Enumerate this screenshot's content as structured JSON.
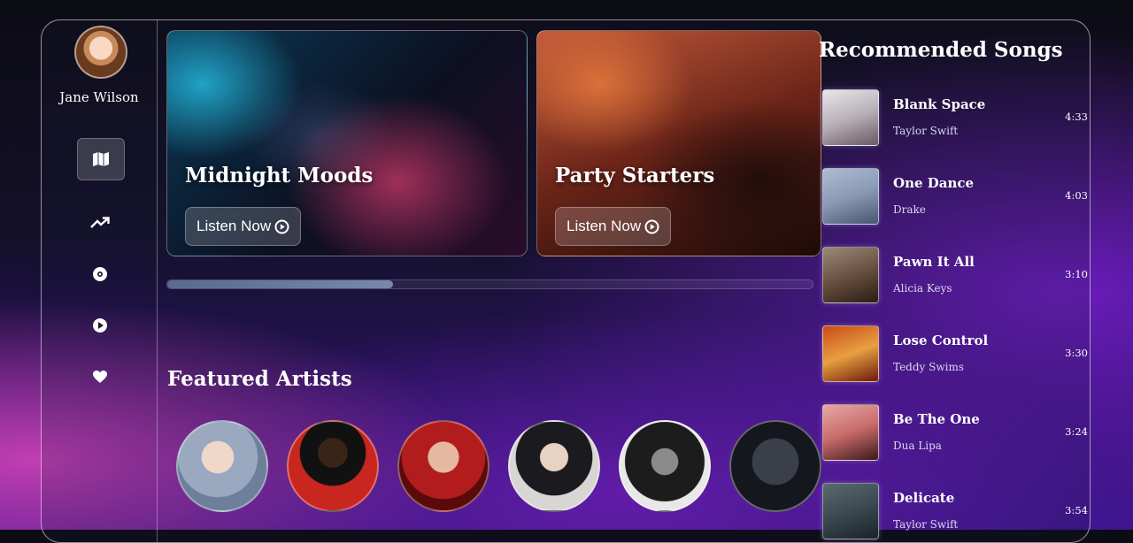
{
  "user": {
    "name": "Jane Wilson"
  },
  "nav": [
    {
      "icon": "map-icon",
      "active": true
    },
    {
      "icon": "trending-icon",
      "active": false
    },
    {
      "icon": "disc-icon",
      "active": false
    },
    {
      "icon": "play-icon",
      "active": false
    },
    {
      "icon": "heart-icon",
      "active": false
    }
  ],
  "playlists": [
    {
      "title": "Midnight Moods",
      "button": "Listen Now"
    },
    {
      "title": "Party Starters",
      "button": "Listen Now"
    }
  ],
  "carousel": {
    "progress": 0.35
  },
  "featured": {
    "title": "Featured Artists",
    "artists": [
      {
        "name": "artist-1"
      },
      {
        "name": "artist-2"
      },
      {
        "name": "artist-3"
      },
      {
        "name": "artist-4"
      },
      {
        "name": "artist-5"
      },
      {
        "name": "artist-6"
      }
    ]
  },
  "recommended": {
    "title": "Recommended Songs",
    "songs": [
      {
        "title": "Blank Space",
        "artist": "Taylor Swift",
        "duration": "4:33"
      },
      {
        "title": "One Dance",
        "artist": "Drake",
        "duration": "4:03"
      },
      {
        "title": "Pawn It All",
        "artist": "Alicia Keys",
        "duration": "3:10"
      },
      {
        "title": "Lose Control",
        "artist": "Teddy Swims",
        "duration": "3:30"
      },
      {
        "title": "Be The One",
        "artist": "Dua Lipa",
        "duration": "3:24"
      },
      {
        "title": "Delicate",
        "artist": "Taylor Swift",
        "duration": "3:54"
      }
    ]
  }
}
